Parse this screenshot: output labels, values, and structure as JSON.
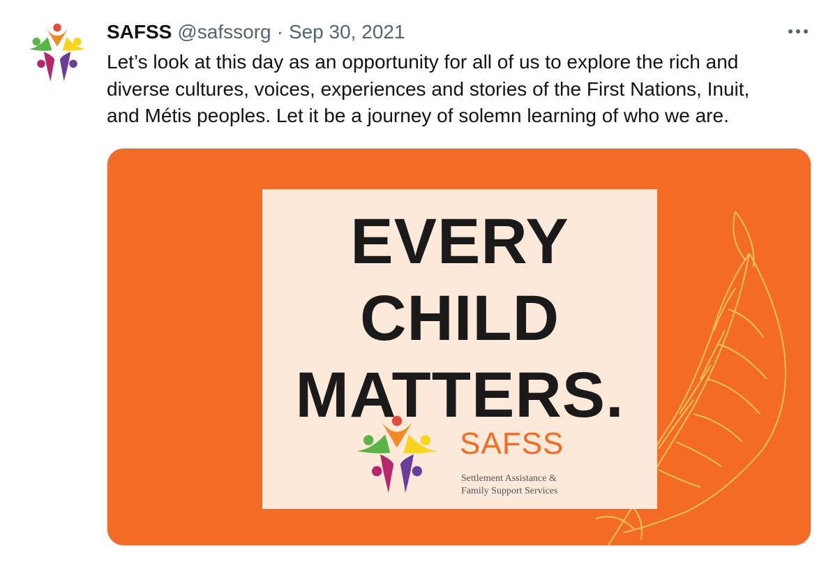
{
  "tweet": {
    "author": {
      "display_name": "SAFSS",
      "handle": "@safssorg",
      "avatar_icon": "safss-logo-icon"
    },
    "separator": "·",
    "date": "Sep 30, 2021",
    "more_icon": "more-options-icon",
    "text": "Let’s look at this day as an opportunity for all of us to explore the rich and\ndiverse cultures, voices, experiences and stories of the First Nations, Inuit,\nand Métis peoples. Let it be a journey of solemn learning of who we are.",
    "media": {
      "headline_lines": [
        "EVERY",
        "CHILD",
        "MATTERS."
      ],
      "brand": "SAFSS",
      "brand_sub": "Settlement Assistance &\nFamily Support Services",
      "decoration_icon": "feather-icon"
    }
  },
  "colors": {
    "orange": "#f36b25",
    "poster_bg": "#fde9d9",
    "feather": "#f6c55a",
    "text_primary": "#0f1419",
    "text_secondary": "#536471",
    "logo_red": "#e94b3c",
    "logo_yellow": "#f7d41e",
    "logo_green": "#5bb447",
    "logo_purple": "#6a3d9a",
    "logo_magenta": "#b5276a",
    "logo_orange": "#f08a24"
  }
}
